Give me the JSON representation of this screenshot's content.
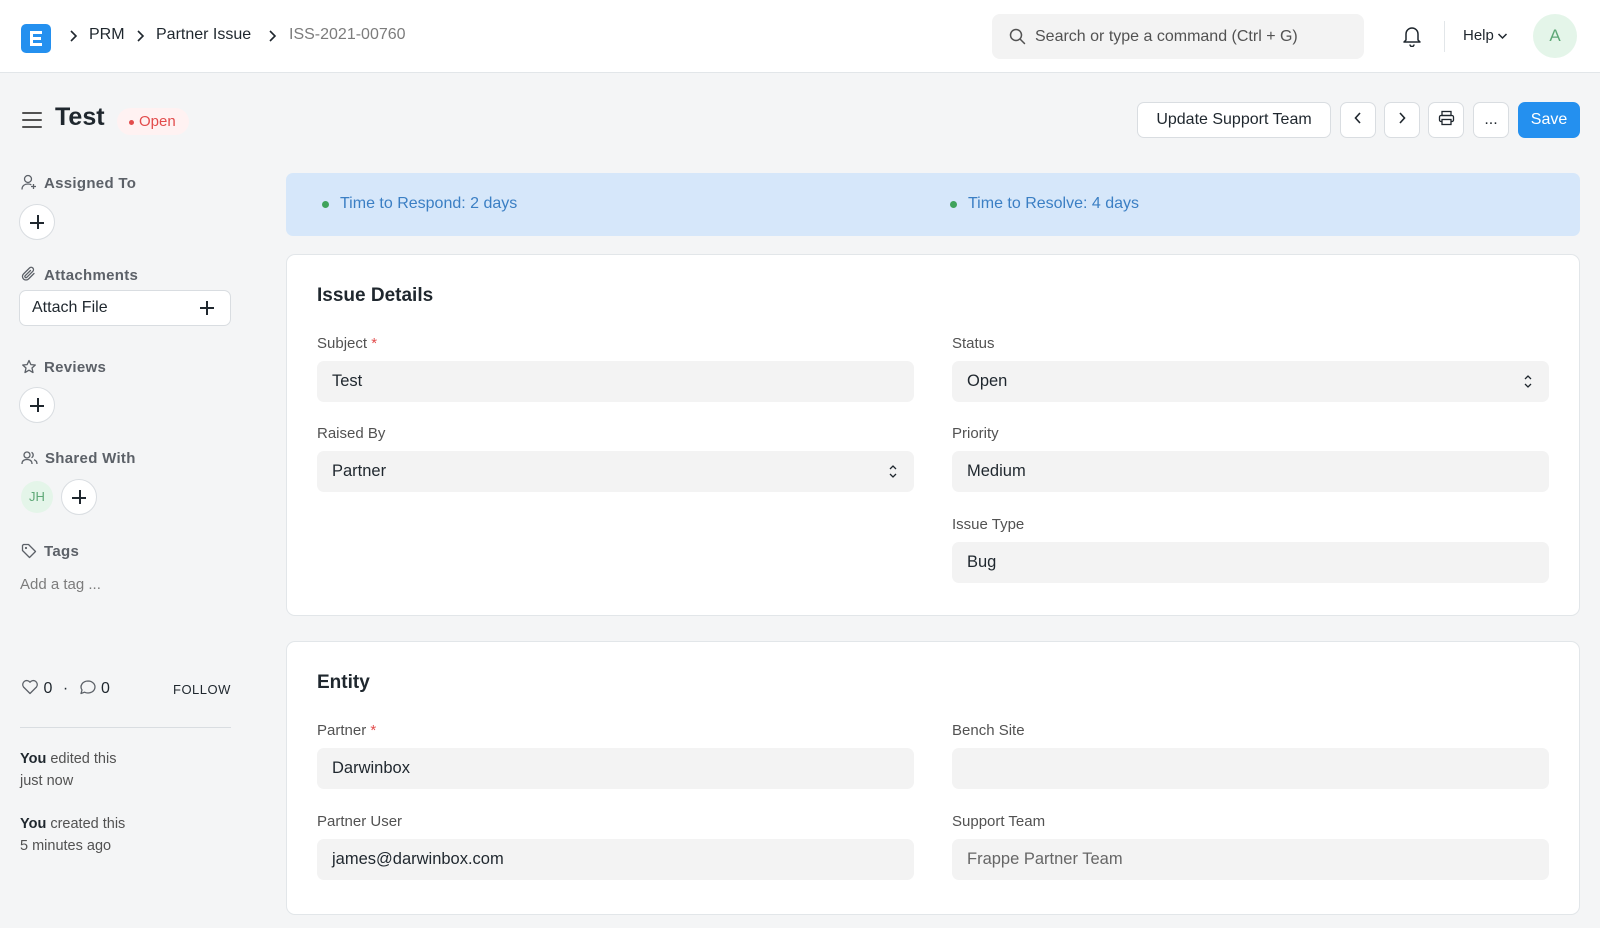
{
  "navbar": {
    "breadcrumbs": [
      "PRM",
      "Partner Issue",
      "ISS-2021-00760"
    ],
    "search_placeholder": "Search or type a command (Ctrl + G)",
    "help_label": "Help",
    "avatar_initial": "A"
  },
  "page": {
    "title": "Test",
    "status": "Open",
    "actions": {
      "update_support_team": "Update Support Team",
      "more": "...",
      "save": "Save"
    }
  },
  "sidebar": {
    "assigned_to": "Assigned To",
    "attachments": "Attachments",
    "attach_file": "Attach File",
    "reviews": "Reviews",
    "shared_with": "Shared With",
    "shared_user_initials": "JH",
    "tags": "Tags",
    "add_tag": "Add a tag ...",
    "likes": "0",
    "separator": "·",
    "comments": "0",
    "follow": "FOLLOW",
    "activity": [
      {
        "actor": "You",
        "text": "edited this",
        "time": "just now"
      },
      {
        "actor": "You",
        "text": "created this",
        "time": "5 minutes ago"
      }
    ]
  },
  "sla": {
    "respond": "Time to Respond: 2 days",
    "resolve": "Time to Resolve: 4 days",
    "dot_color": "#3fa35b"
  },
  "issue_details": {
    "title": "Issue Details",
    "subject_label": "Subject",
    "subject": "Test",
    "status_label": "Status",
    "status": "Open",
    "raised_by_label": "Raised By",
    "raised_by": "Partner",
    "priority_label": "Priority",
    "priority": "Medium",
    "issue_type_label": "Issue Type",
    "issue_type": "Bug"
  },
  "entity": {
    "title": "Entity",
    "partner_label": "Partner",
    "partner": "Darwinbox",
    "bench_site_label": "Bench Site",
    "bench_site": "",
    "partner_user_label": "Partner User",
    "partner_user": "james@darwinbox.com",
    "support_team_label": "Support Team",
    "support_team": "Frappe Partner Team"
  },
  "colors": {
    "primary": "#2490ef",
    "danger": "#e24c4c",
    "sla_background": "#d6e7fa"
  }
}
